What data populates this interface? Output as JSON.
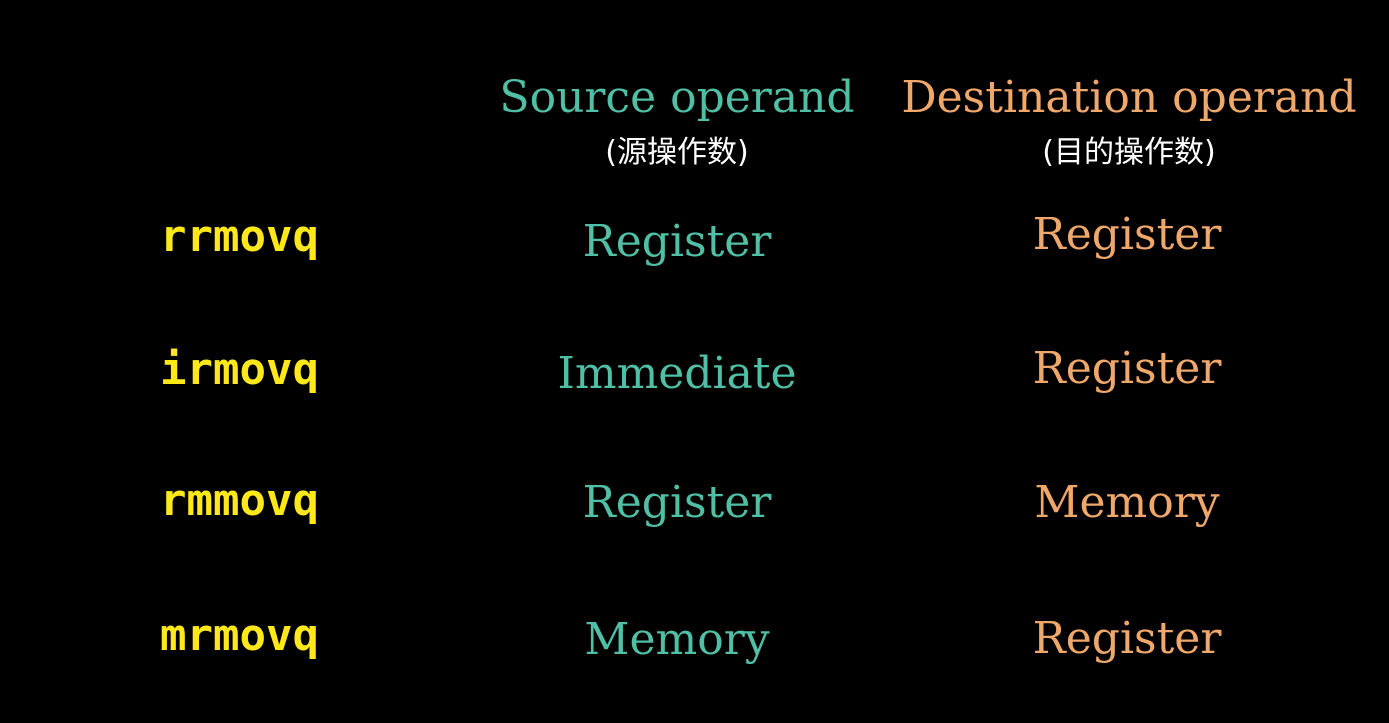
{
  "headers": {
    "source": {
      "title": "Source operand",
      "subtitle": "(源操作数)"
    },
    "destination": {
      "title": "Destination operand",
      "subtitle": "(目的操作数)"
    }
  },
  "colors": {
    "background": "#000000",
    "instruction": "#ffe81a",
    "source": "#4fbfa5",
    "destination": "#f0a86a",
    "subtitle": "#ffffff"
  },
  "rows": [
    {
      "instruction": "rrmovq",
      "source": "Register",
      "destination": "Register"
    },
    {
      "instruction": "irmovq",
      "source": "Immediate",
      "destination": "Register"
    },
    {
      "instruction": "rmmovq",
      "source": "Register",
      "destination": "Memory"
    },
    {
      "instruction": "mrmovq",
      "source": "Memory",
      "destination": "Register"
    }
  ]
}
